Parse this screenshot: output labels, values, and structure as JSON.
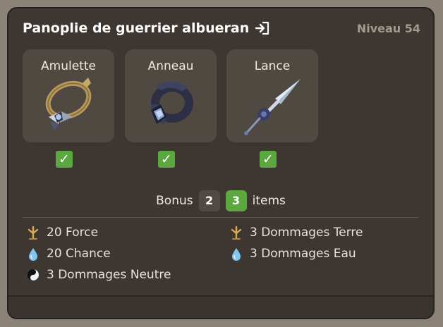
{
  "set": {
    "title": "Panoplie de guerrier albueran",
    "level": "Niveau 54",
    "icons": {
      "action": "enter-icon"
    }
  },
  "items": [
    {
      "label": "Amulette",
      "icon": "amulet-icon",
      "equipped": true
    },
    {
      "label": "Anneau",
      "icon": "ring-icon",
      "equipped": true
    },
    {
      "label": "Lance",
      "icon": "spear-icon",
      "equipped": true
    }
  ],
  "bonus": {
    "label": "Bonus",
    "options": [
      "2",
      "3"
    ],
    "selected": "3",
    "suffix": "items"
  },
  "stats": [
    {
      "text": "20 Force",
      "icon": "earth-element-icon"
    },
    {
      "text": "3 Dommages Terre",
      "icon": "earth-element-icon"
    },
    {
      "text": "20 Chance",
      "icon": "water-element-icon"
    },
    {
      "text": "3 Dommages Eau",
      "icon": "water-element-icon"
    },
    {
      "text": "3 Dommages Neutre",
      "icon": "neutral-element-icon"
    }
  ],
  "colors": {
    "panel": "#3e3731",
    "card": "#504942",
    "check": "#5aa83f",
    "text": "#efe9e1",
    "muted": "#a39b8f"
  }
}
